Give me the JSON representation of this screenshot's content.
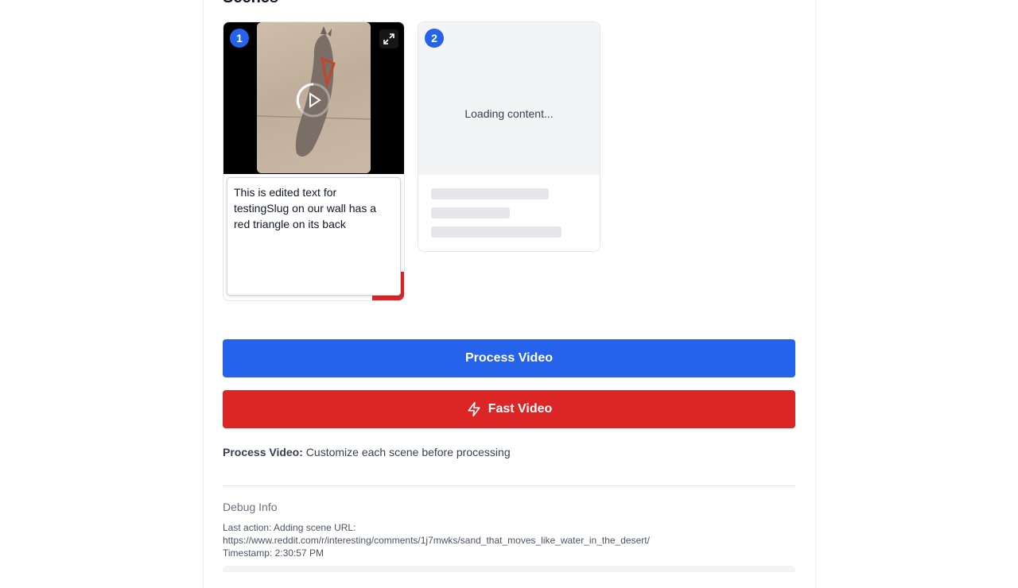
{
  "section": {
    "title": "Scenes"
  },
  "scenes": [
    {
      "number": "1",
      "caption": "This is edited text for testingSlug on our wall has a red triangle on its back"
    },
    {
      "number": "2",
      "loading_text": "Loading content..."
    }
  ],
  "buttons": {
    "process_label": "Process Video",
    "fast_label": "Fast Video"
  },
  "hint": {
    "label": "Process Video:",
    "text": " Customize each scene before processing"
  },
  "debug": {
    "title": "Debug Info",
    "last_action": "Last action: Adding scene URL:",
    "url": "https://www.reddit.com/r/interesting/comments/1j7mwks/sand_that_moves_like_water_in_the_desert/",
    "timestamp": "Timestamp: 2:30:57 PM"
  },
  "colors": {
    "primary": "#2563eb",
    "danger": "#dc2626",
    "skeleton": "#e5e7eb"
  },
  "icons": [
    "expand-icon",
    "play-icon",
    "spinner-icon",
    "lightning-icon"
  ]
}
